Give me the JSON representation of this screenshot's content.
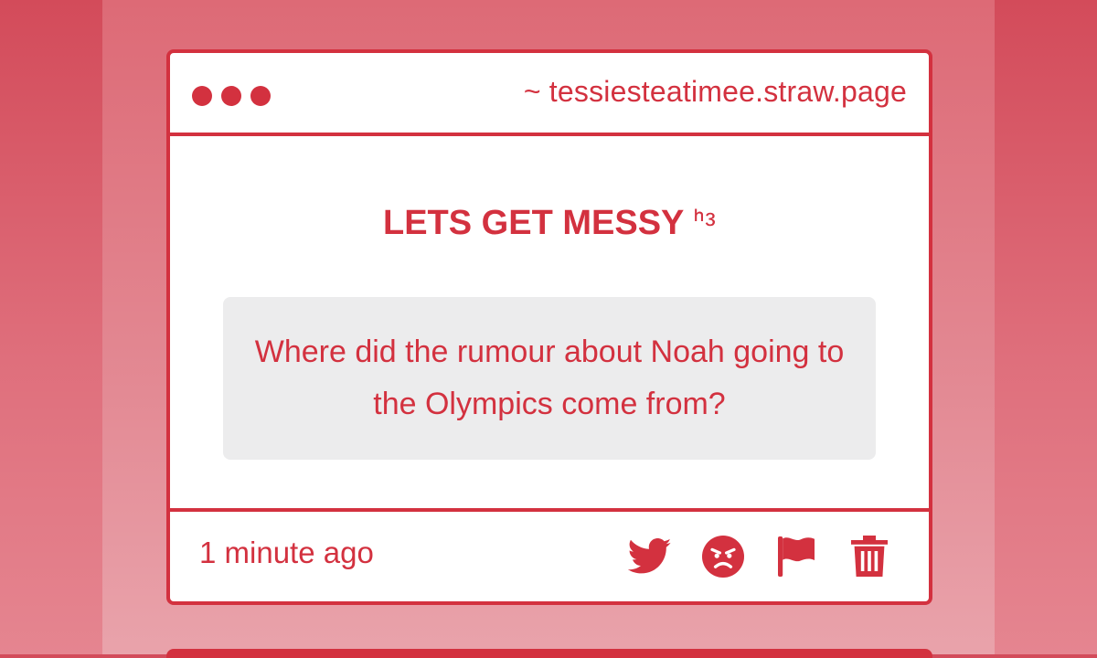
{
  "window": {
    "url": "~ tessiesteatimee.straw.page"
  },
  "card": {
    "heading": "LETS GET MESSY",
    "heading_emoji": "ᑋᵌ",
    "question": "Where did the rumour about Noah going to the Olympics come from?",
    "timestamp": "1 minute ago"
  },
  "actions": [
    {
      "icon": "twitter-icon"
    },
    {
      "icon": "angry-face-icon"
    },
    {
      "icon": "flag-icon"
    },
    {
      "icon": "trash-icon"
    }
  ],
  "colors": {
    "accent": "#d3313f",
    "question_bg": "#ececed",
    "card_bg": "#ffffff"
  }
}
